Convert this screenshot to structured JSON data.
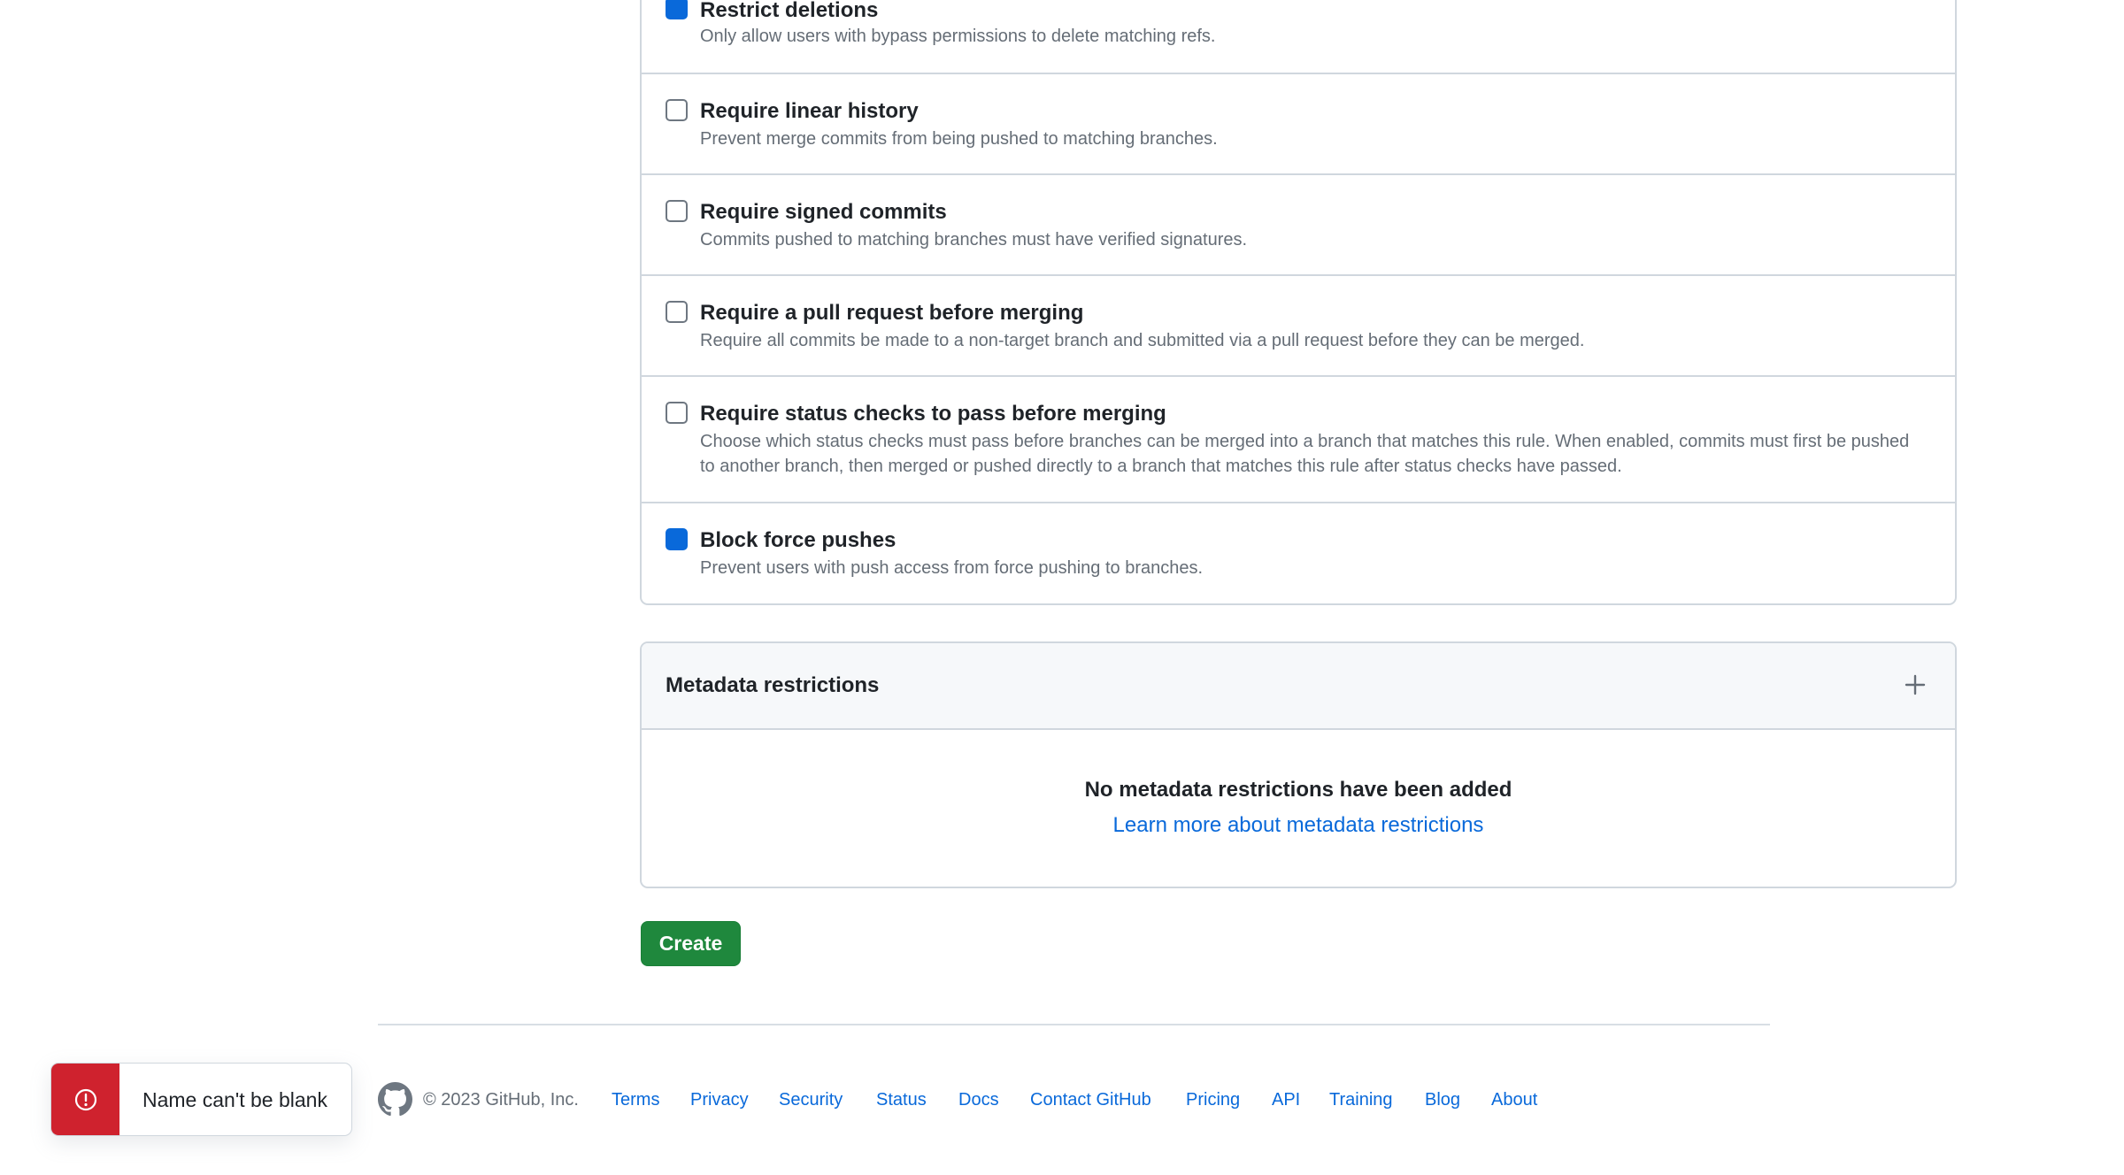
{
  "rules": [
    {
      "title": "Restrict deletions",
      "description": "Only allow users with bypass permissions to delete matching refs.",
      "checked": true
    },
    {
      "title": "Require linear history",
      "description": "Prevent merge commits from being pushed to matching branches.",
      "checked": false
    },
    {
      "title": "Require signed commits",
      "description": "Commits pushed to matching branches must have verified signatures.",
      "checked": false
    },
    {
      "title": "Require a pull request before merging",
      "description": "Require all commits be made to a non-target branch and submitted via a pull request before they can be merged.",
      "checked": false
    },
    {
      "title": "Require status checks to pass before merging",
      "description": "Choose which status checks must pass before branches can be merged into a branch that matches this rule. When enabled, commits must first be pushed to another branch, then merged or pushed directly to a branch that matches this rule after status checks have passed.",
      "checked": false
    },
    {
      "title": "Block force pushes",
      "description": "Prevent users with push access from force pushing to branches.",
      "checked": true
    }
  ],
  "metadata": {
    "title": "Metadata restrictions",
    "add_icon": "plus-icon",
    "empty_title": "No metadata restrictions have been added",
    "learn_more": "Learn more about metadata restrictions"
  },
  "create_label": "Create",
  "footer": {
    "logo_icon": "github-mark-icon",
    "copyright": "© 2023 GitHub, Inc.",
    "links": [
      "Terms",
      "Privacy",
      "Security",
      "Status",
      "Docs",
      "Contact GitHub",
      "Pricing",
      "API",
      "Training",
      "Blog",
      "About"
    ]
  },
  "toast": {
    "icon": "alert-circle-icon",
    "message": "Name can't be blank"
  },
  "colors": {
    "checkbox_checked": "#0969da",
    "create_button": "#1f883d",
    "toast_error": "#cf222e",
    "link": "#0969da"
  }
}
